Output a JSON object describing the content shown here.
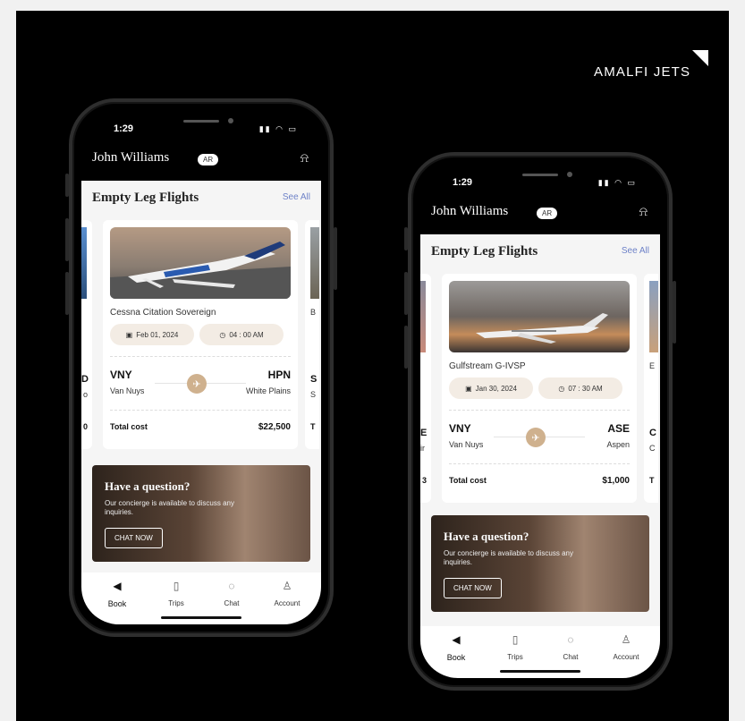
{
  "brand": {
    "name": "AMALFI JETS"
  },
  "colors": {
    "accent": "#6e82c8",
    "pill": "#f3ece4",
    "plane_dot": "#cfb18e"
  },
  "phones": [
    {
      "status_time": "1:29",
      "user_name": "John Williams",
      "badge": "AR",
      "bell_icon": "bell-icon",
      "section_title": "Empty Leg Flights",
      "see_all": "See All",
      "card": {
        "model": "Cessna Citation Sovereign",
        "date": "Feb 01, 2024",
        "time": "04 : 00 AM",
        "from_code": "VNY",
        "from_city": "Van Nuys",
        "to_code": "HPN",
        "to_city": "White Plains",
        "total_label": "Total cost",
        "total_value": "$22,500"
      },
      "left_peek": {
        "code": "D",
        "city": "o",
        "total": "0"
      },
      "right_peek": {
        "model": "B",
        "code": "S",
        "city": "S",
        "total": "T"
      },
      "promo": {
        "title": "Have a question?",
        "body": "Our concierge is available to discuss any inquiries.",
        "button": "CHAT NOW"
      },
      "tabs": [
        "Book",
        "Trips",
        "Chat",
        "Account"
      ]
    },
    {
      "status_time": "1:29",
      "user_name": "John Williams",
      "badge": "AR",
      "bell_icon": "bell-icon",
      "section_title": "Empty Leg Flights",
      "see_all": "See All",
      "card": {
        "model": "Gulfstream G-IVSP",
        "date": "Jan 30, 2024",
        "time": "07 : 30 AM",
        "from_code": "VNY",
        "from_city": "Van Nuys",
        "to_code": "ASE",
        "to_city": "Aspen",
        "total_label": "Total cost",
        "total_value": "$1,000"
      },
      "left_peek": {
        "code": "E",
        "city": "ir",
        "total": "3"
      },
      "right_peek": {
        "model": "E",
        "code": "C",
        "city": "C",
        "total": "T"
      },
      "promo": {
        "title": "Have a question?",
        "body": "Our concierge is available to discuss any inquiries.",
        "button": "CHAT NOW"
      },
      "tabs": [
        "Book",
        "Trips",
        "Chat",
        "Account"
      ]
    }
  ]
}
